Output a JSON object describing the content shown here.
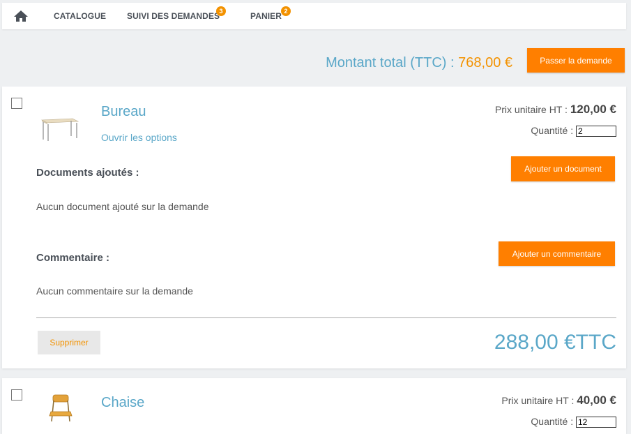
{
  "nav": {
    "items": [
      {
        "label": "CATALOGUE",
        "badge": null
      },
      {
        "label": "SUIVI DES DEMANDES",
        "badge": "3"
      },
      {
        "label": "PANIER",
        "badge": "2"
      }
    ]
  },
  "summary": {
    "total_label": "Montant total (TTC) : ",
    "total_value": "768,00 €",
    "submit_label": "Passer la demande"
  },
  "items": [
    {
      "name": "Bureau",
      "options_label": "Ouvrir les options",
      "unit_price_label": "Prix unitaire HT : ",
      "unit_price": "120,00 €",
      "quantity_label": "Quantité : ",
      "quantity": "2",
      "documents_title": "Documents ajoutés :",
      "documents_empty": "Aucun document ajouté sur la demande",
      "add_document_label": "Ajouter un document",
      "comment_title": "Commentaire :",
      "comment_empty": "Aucun commentaire sur la demande",
      "add_comment_label": "Ajouter un commentaire",
      "delete_label": "Supprimer",
      "line_total": "288,00 €TTC"
    },
    {
      "name": "Chaise",
      "unit_price_label": "Prix unitaire HT : ",
      "unit_price": "40,00 €",
      "quantity_label": "Quantité : ",
      "quantity": "12"
    }
  ],
  "colors": {
    "accent_orange": "#ff7f00",
    "link_blue": "#5aa7c8",
    "badge_orange": "#f39200"
  }
}
